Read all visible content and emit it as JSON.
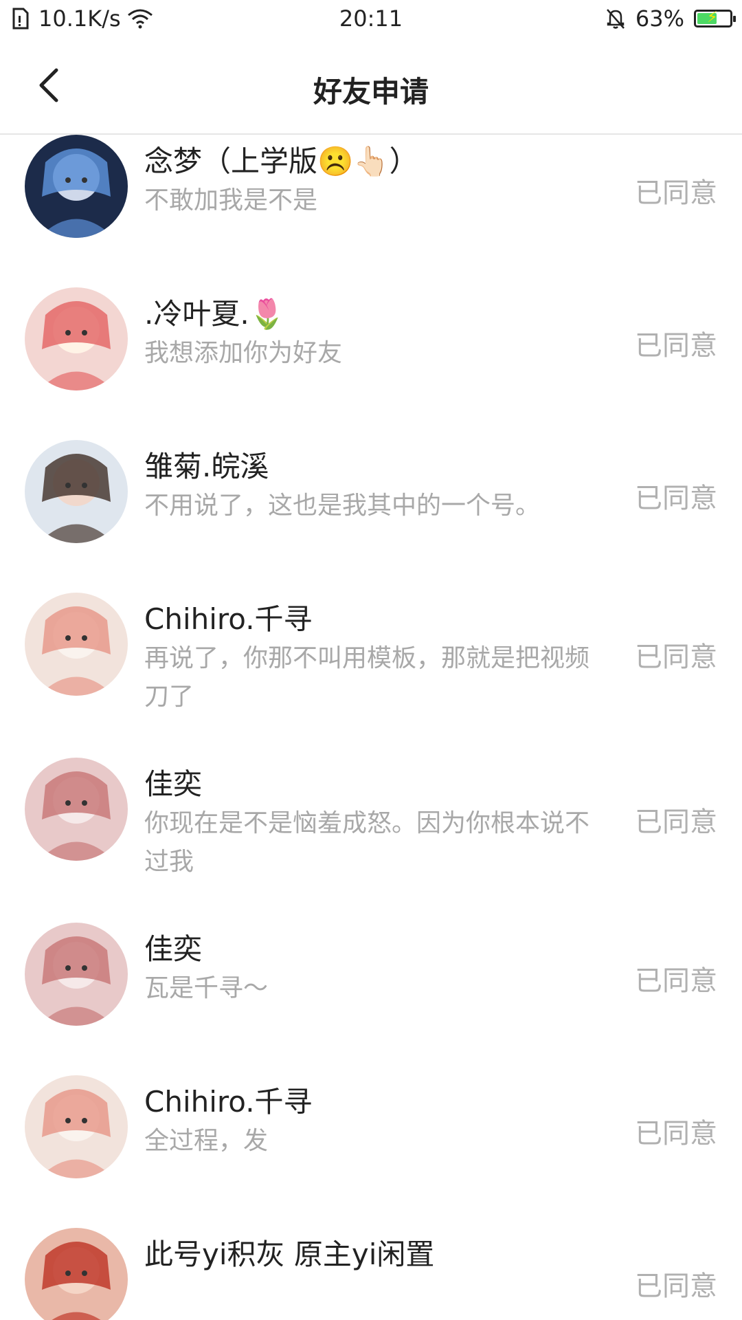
{
  "status_bar": {
    "network_speed": "10.1K/s",
    "time": "20:11",
    "battery_percent": "63%",
    "battery_level": 0.63,
    "battery_color": "#4cd964"
  },
  "nav": {
    "title": "好友申请",
    "back_icon": "chevron-left-icon"
  },
  "requests": [
    {
      "name": "念梦（上学版☹️👆🏻）",
      "message": "不敢加我是不是",
      "status": "已同意",
      "avatar_palette": [
        "#1c2b4a",
        "#5b8fd6",
        "#cfd8ea"
      ]
    },
    {
      "name": "  .冷叶夏.🌷",
      "message": "我想添加你为好友",
      "status": "已同意",
      "avatar_palette": [
        "#f3d6d2",
        "#e46a6a",
        "#fff3e6"
      ]
    },
    {
      "name": "雏菊.皖溪",
      "message": "不用说了，这也是我其中的一个号。",
      "status": "已同意",
      "avatar_palette": [
        "#dfe6ee",
        "#4a3a33",
        "#f1d8cc"
      ]
    },
    {
      "name": "Chihiro.千寻",
      "message": "再说了，你那不叫用模板，那就是把视频刀了",
      "status": "已同意",
      "avatar_palette": [
        "#f2e3dc",
        "#e89a8c",
        "#faf3ee"
      ]
    },
    {
      "name": "佳奕",
      "message": "你现在是不是恼羞成怒。因为你根本说不过我",
      "status": "已同意",
      "avatar_palette": [
        "#e8c9c9",
        "#c97a7a",
        "#f6e9e9"
      ]
    },
    {
      "name": "佳奕",
      "message": "瓦是千寻～",
      "status": "已同意",
      "avatar_palette": [
        "#e8c9c9",
        "#c97a7a",
        "#f6e9e9"
      ]
    },
    {
      "name": "Chihiro.千寻",
      "message": "全过程，发",
      "status": "已同意",
      "avatar_palette": [
        "#f2e3dc",
        "#e89a8c",
        "#faf3ee"
      ]
    },
    {
      "name": "此号yi积灰  原主yi闲置",
      "message": "",
      "status": "已同意",
      "avatar_palette": [
        "#e9b8a8",
        "#c0392b",
        "#f5d5c6"
      ]
    }
  ]
}
